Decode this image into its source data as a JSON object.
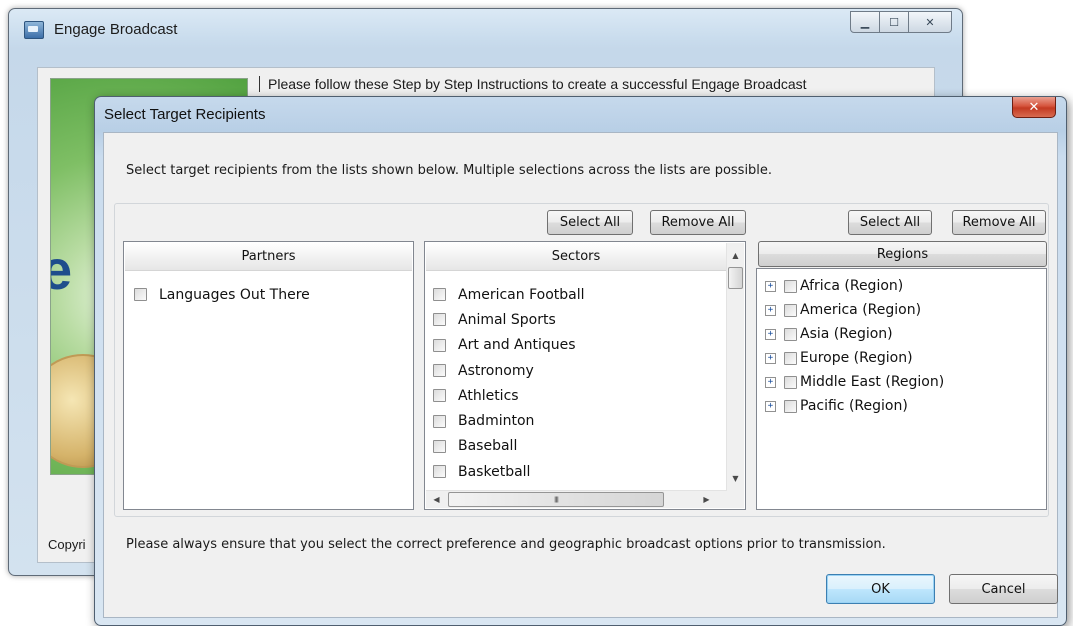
{
  "background_window": {
    "title": "Engage Broadcast",
    "controls": {
      "minimize": "▁",
      "maximize": "☐",
      "close": "✕"
    },
    "instruction": "Please follow these Step by Step Instructions to create a successful Engage Broadcast",
    "copyright_partial": "Copyri"
  },
  "dialog": {
    "title": "Select Target Recipients",
    "close_glyph": "✕",
    "instructions": "Select target recipients from the lists shown below. Multiple selections across the lists are possible.",
    "sectors_select_all": "Select All",
    "sectors_remove_all": "Remove All",
    "regions_select_all": "Select All",
    "regions_remove_all": "Remove All",
    "partners": {
      "header": "Partners",
      "items": [
        {
          "label": "Languages Out There",
          "checked": false
        }
      ]
    },
    "sectors": {
      "header": "Sectors",
      "items": [
        {
          "label": "American Football",
          "checked": false
        },
        {
          "label": "Animal Sports",
          "checked": false
        },
        {
          "label": "Art and Antiques",
          "checked": false
        },
        {
          "label": "Astronomy",
          "checked": false
        },
        {
          "label": "Athletics",
          "checked": false
        },
        {
          "label": "Badminton",
          "checked": false
        },
        {
          "label": "Baseball",
          "checked": false
        },
        {
          "label": "Basketball",
          "checked": false
        }
      ]
    },
    "regions": {
      "header": "Regions",
      "expander_glyph": "+",
      "items": [
        {
          "label": "Africa (Region)",
          "checked": false
        },
        {
          "label": "America (Region)",
          "checked": false
        },
        {
          "label": "Asia (Region)",
          "checked": false
        },
        {
          "label": "Europe (Region)",
          "checked": false
        },
        {
          "label": "Middle East (Region)",
          "checked": false
        },
        {
          "label": "Pacific (Region)",
          "checked": false
        }
      ]
    },
    "footer_note": "Please always ensure that you select the correct preference and geographic broadcast options prior to transmission.",
    "ok_label": "OK",
    "cancel_label": "Cancel",
    "scroll": {
      "up": "▲",
      "down": "▼",
      "left": "◀",
      "right": "▶",
      "grip": "III"
    }
  },
  "colors": {
    "dialog_frame": "#c6d9ec",
    "close_button": "#d6553e",
    "panel_background": "#f0f0f0"
  }
}
